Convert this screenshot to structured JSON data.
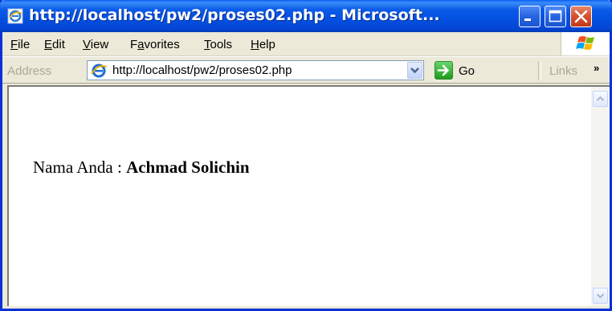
{
  "window": {
    "title": "http://localhost/pw2/proses02.php - Microsoft..."
  },
  "menu": {
    "items": [
      {
        "label": "File",
        "accel": "F",
        "rest": "ile"
      },
      {
        "label": "Edit",
        "accel": "E",
        "rest": "dit"
      },
      {
        "label": "View",
        "accel": "V",
        "rest": "iew"
      },
      {
        "label": "Favorites",
        "pre": "F",
        "accel": "a",
        "rest": "vorites"
      },
      {
        "label": "Tools",
        "accel": "T",
        "rest": "ools"
      },
      {
        "label": "Help",
        "accel": "H",
        "rest": "elp"
      }
    ]
  },
  "address": {
    "label": "Address",
    "url": "http://localhost/pw2/proses02.php",
    "go_label": "Go",
    "links_label": "Links",
    "links_chevron": "»"
  },
  "page": {
    "label": "Nama Anda : ",
    "name": "Achmad Solichin"
  },
  "colors": {
    "titlebar": "#0350e0",
    "frame": "#0831d9",
    "chrome": "#ece9d8",
    "close_button": "#c1391a",
    "go_button": "#1d9b1d"
  },
  "icons": [
    "ie-page-icon",
    "minimize-icon",
    "maximize-icon",
    "close-icon",
    "windows-logo-icon",
    "ie-address-icon",
    "dropdown-arrow-icon",
    "go-arrow-icon",
    "scroll-up-icon",
    "scroll-down-icon"
  ]
}
